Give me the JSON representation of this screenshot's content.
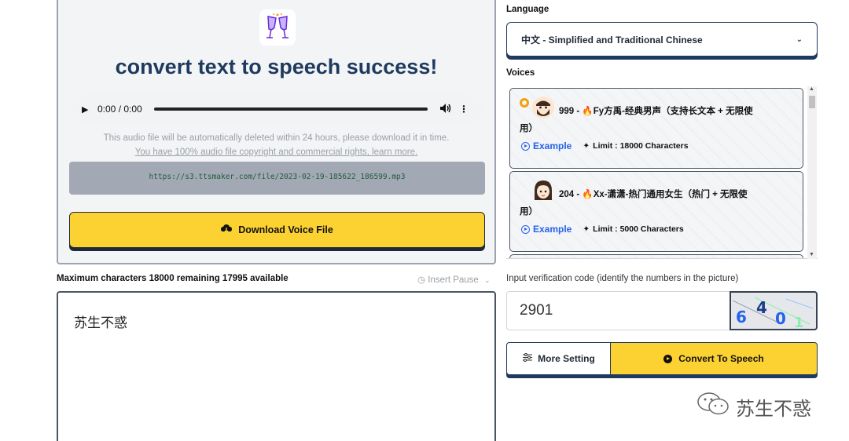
{
  "result": {
    "title": "convert text to speech success!",
    "audio_time": "0:00 / 0:00",
    "delete_note": "This audio file will be automatically deleted within 24 hours, please download it in time.",
    "rights_link": "You have 100% audio file copyright and commercial rights, learn more.",
    "file_url": "https://s3.ttsmaker.com/file/2023-02-19-185622_186599.mp3",
    "download_label": "Download Voice File"
  },
  "editor": {
    "char_count": "Maximum characters 18000 remaining 17995 available",
    "insert_pause": "Insert Pause",
    "text": "苏生不惑"
  },
  "language": {
    "label": "Language",
    "selected": "中文 - Simplified and Traditional Chinese"
  },
  "voices": {
    "label": "Voices",
    "items": [
      {
        "title": "999 - 🔥Fy方禹-经典男声（支持长文本 + 无限使",
        "title_cont": "用）",
        "example": "Example",
        "limit": "Limit : 18000 Characters",
        "selected": true
      },
      {
        "title": "204 - 🔥Xx-潇潇-热门通用女生（热门 + 无限使",
        "title_cont": "用）",
        "example": "Example",
        "limit": "Limit : 5000 Characters",
        "selected": false
      }
    ]
  },
  "verify": {
    "label": "Input verification code (identify the numbers in the picture)",
    "value": "2901",
    "captcha_digits": [
      "6",
      "4",
      "0",
      "1"
    ]
  },
  "actions": {
    "more_setting": "More Setting",
    "convert": "Convert To Speech"
  },
  "watermark": "苏生不惑",
  "colors": {
    "accent_yellow": "#fcd232",
    "navy": "#1f3a5f",
    "link_blue": "#2563eb",
    "radio_orange": "#f59e0b"
  }
}
